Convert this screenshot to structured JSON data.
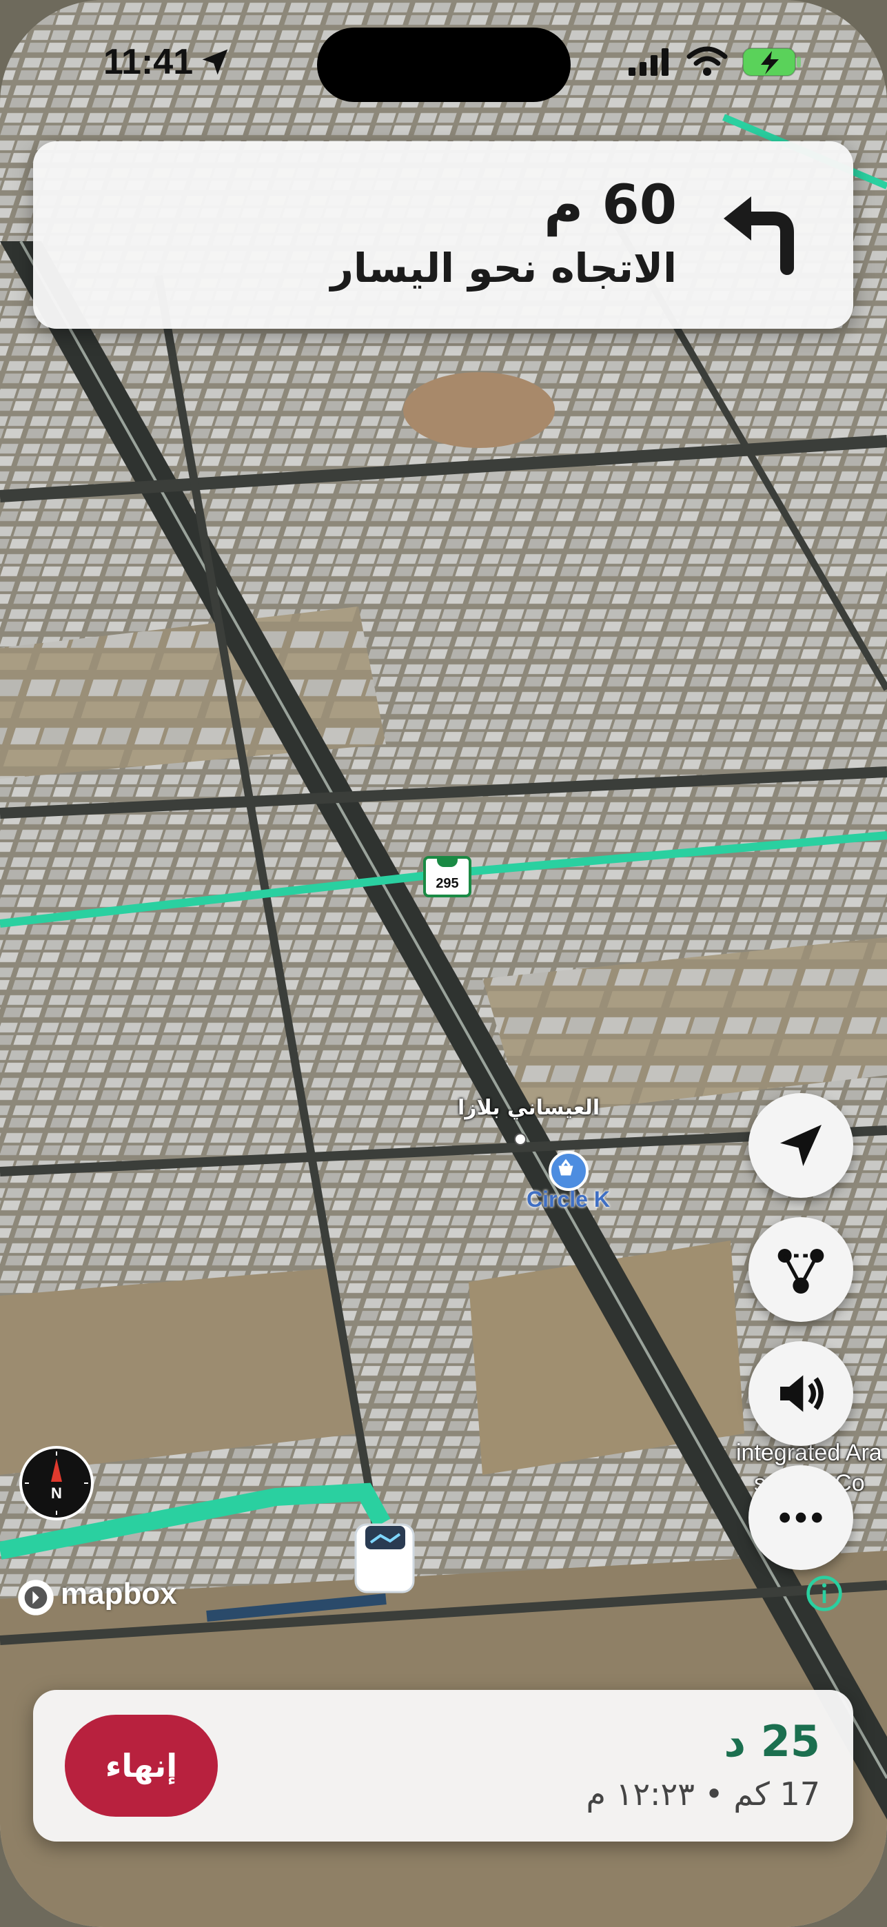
{
  "status_bar": {
    "time": "11:41",
    "icons": [
      "location-arrow-icon",
      "signal-icon",
      "wifi-icon",
      "battery-charging-icon"
    ]
  },
  "instruction": {
    "distance": "60 م",
    "text": "الاتجاه نحو اليسار",
    "icon": "turn-left-icon"
  },
  "map": {
    "route_color": "#2ad0a0",
    "poi_label": "العيساني بلازا",
    "store_label": "Circle K",
    "road_shield": "295",
    "service_label_line1": "integrated Ara",
    "service_label_line2": "service Co"
  },
  "side_buttons": [
    "recenter-icon",
    "route-overview-icon",
    "sound-icon",
    "more-icon"
  ],
  "compass": {
    "label": "N"
  },
  "attribution": {
    "text": "mapbox"
  },
  "trip": {
    "eta_minutes": "25 د",
    "details": "17 كم • ١٢:٢٣ م",
    "end_label": "إنهاء"
  },
  "colors": {
    "end_button": "#b8213e",
    "eta_text": "#1b6f4f",
    "banner_bg": "#f6f6f6"
  }
}
